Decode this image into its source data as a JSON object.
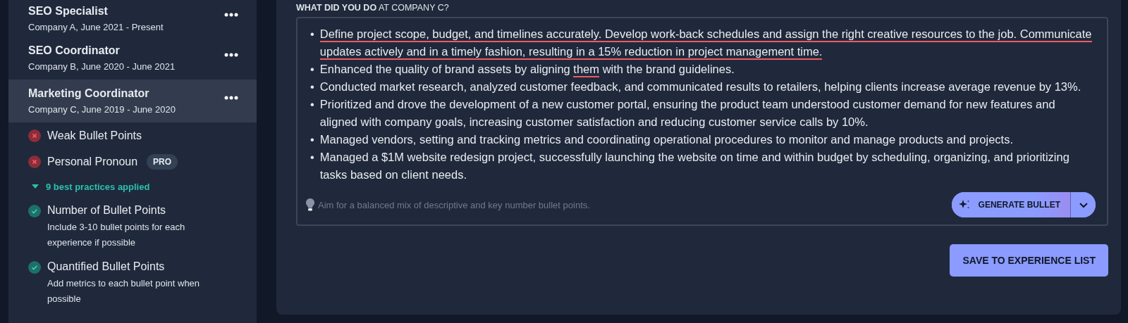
{
  "experiences": [
    {
      "title": "SEO Specialist",
      "subtitle": "Company A, June 2021 - Present",
      "selected": false
    },
    {
      "title": "SEO Coordinator",
      "subtitle": "Company B, June 2020 - June 2021",
      "selected": false
    },
    {
      "title": "Marketing Coordinator",
      "subtitle": "Company C, June 2019 - June 2020",
      "selected": true
    }
  ],
  "issues": [
    {
      "kind": "error",
      "label": "Weak Bullet Points"
    },
    {
      "kind": "error",
      "label": "Personal Pronoun",
      "badge": "PRO"
    }
  ],
  "practices_toggle": {
    "label": "9 best practices applied",
    "expanded": true
  },
  "practices": [
    {
      "kind": "passed",
      "label": "Number of Bullet Points",
      "hint": "Include 3-10 bullet points for each experience if possible"
    },
    {
      "kind": "passed",
      "label": "Quantified Bullet Points",
      "hint": "Add metrics to each bullet point when possible"
    }
  ],
  "editor": {
    "label": "**WHAT DID YOU DO** AT COMPANY C?",
    "bullets": [
      {
        "marker": "•",
        "segments": [
          {
            "text": "Define project scope, budget, and timelines accurately. Develop work-back schedules and assign the right creative resources to the job. Communicate updates actively and in a timely fashion, resulting in a 15% reduction in project management time.",
            "flagged": true
          }
        ]
      },
      {
        "marker": "•",
        "segments": [
          {
            "text": "Enhanced the quality of brand assets by aligning ",
            "flagged": false
          },
          {
            "text": "them",
            "flagged": true
          },
          {
            "text": " with the brand guidelines.",
            "flagged": false
          }
        ]
      },
      {
        "marker": "•",
        "segments": [
          {
            "text": "Conducted market research, analyzed customer feedback, and communicated results to retailers, helping clients increase average revenue by 13%.",
            "flagged": false
          }
        ]
      },
      {
        "marker": "•",
        "segments": [
          {
            "text": "Prioritized and drove the development of a new customer portal, ensuring the product team understood customer demand for new features and aligned with company goals, increasing customer satisfaction and reducing customer service calls by 10%.",
            "flagged": false
          }
        ]
      },
      {
        "marker": "•",
        "segments": [
          {
            "text": "Managed vendors, setting and tracking metrics and coordinating operational procedures to monitor and manage products and projects.",
            "flagged": false
          }
        ]
      },
      {
        "marker": "•",
        "segments": [
          {
            "text": "Managed a $1M website redesign project, successfully launching the website on time and within budget by scheduling, organizing, and prioritizing tasks based on client needs.",
            "flagged": false
          }
        ]
      }
    ],
    "tip": "Aim for a balanced mix of descriptive and key number bullet points.",
    "generate_button": "GENERATE BULLET"
  },
  "save_button": "SAVE TO EXPERIENCE LIST"
}
